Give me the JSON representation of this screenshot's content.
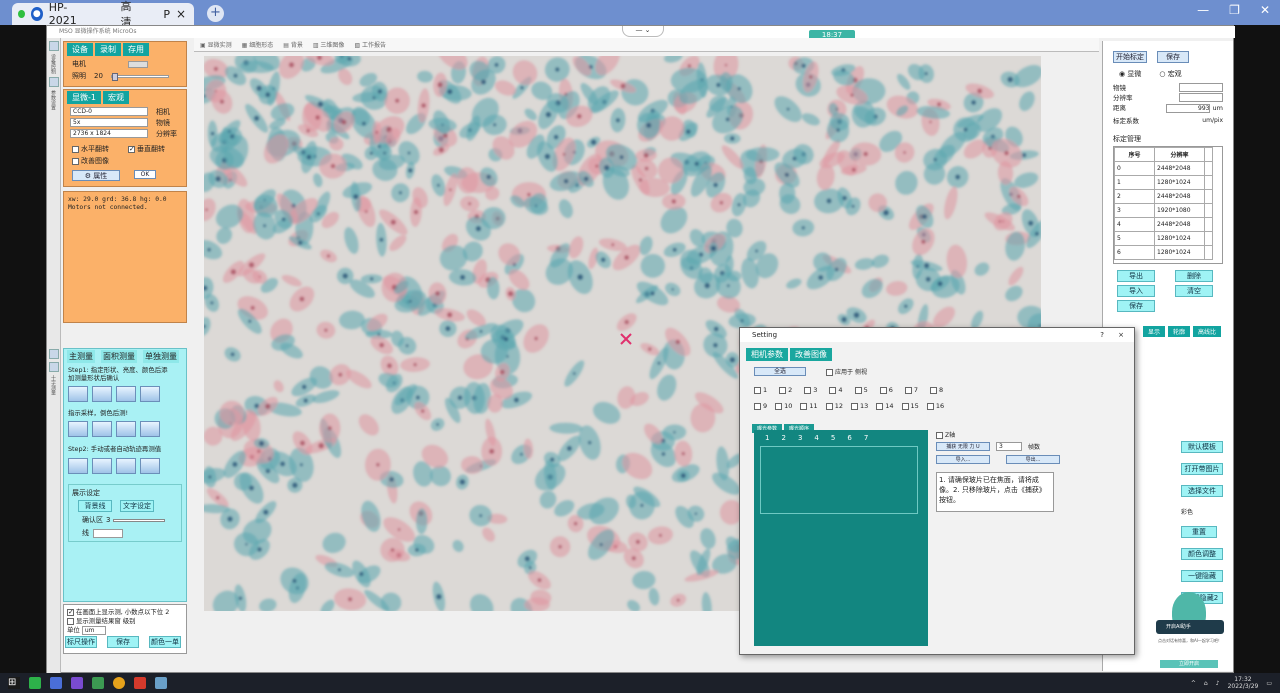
{
  "browser": {
    "tab_title": "HP-2021",
    "tab_quality": "高清",
    "tab_extra": "P",
    "close_glyph": "×",
    "new_tab_glyph": "+"
  },
  "app": {
    "title": "MSO 显微操作系统 MicroOs",
    "time_badge": "18:37",
    "toolbar_items": [
      "显微实测",
      "细胞形态",
      "背景",
      "三维图像",
      "工作报告"
    ]
  },
  "left_rail": {
    "top_label": "设备控制",
    "mid_label": "参数设置",
    "bottom_label": "十字测量"
  },
  "device_panel": {
    "tabs": [
      "设备",
      "录制",
      "存用"
    ],
    "rows": [
      {
        "label": "电机",
        "value": ""
      },
      {
        "label": "照明",
        "value": "20"
      }
    ]
  },
  "camera_panel": {
    "tabs": [
      "显微-1",
      "宏观"
    ],
    "camera": "CCD-0",
    "objective": "5x",
    "resolution": "2736 x 1824",
    "labels": [
      "相机",
      "物镜",
      "分辨率"
    ],
    "checks": [
      {
        "label": "水平翻转",
        "checked": false
      },
      {
        "label": "垂直翻转",
        "checked": true
      },
      {
        "label": "改善图像",
        "checked": false
      }
    ],
    "attr_button": "属性",
    "ok_button": "OK"
  },
  "status_panel": {
    "line1": "xw: 29.0 grd: 36.8 hg: 0.0",
    "line2": "Motors not connected."
  },
  "measure_panel": {
    "tabs": [
      "主测量",
      "面积测量",
      "单独测量"
    ],
    "step1": "Step1: 指定形状、亮度、颜色后添",
    "step1b": "加测量形状后确认",
    "hint": "指示采样，倒色后测!",
    "step2": "Step2: 手动或者自动轨迹再测值",
    "display_title": "展示设定",
    "btn_a": "背景线",
    "btn_b": "文字设定",
    "confirm_label": "确认区",
    "confirm_value": "3",
    "line_label": "线",
    "auto_check": "在画面上显示测, 小数点以下位",
    "auto_check_value": "2",
    "show_result": "显示测量结果窗",
    "level_label": "级别",
    "unit_label": "单位",
    "unit_value": "um",
    "buttons": [
      "标尺操作",
      "保存",
      "颜色一单"
    ]
  },
  "calib_panel": {
    "start_button": "开始标定",
    "save_button": "保存",
    "radio_micro": "显微",
    "radio_macro": "宏观",
    "fields": [
      {
        "label": "物镜",
        "value": ""
      },
      {
        "label": "分辨率",
        "value": ""
      },
      {
        "label": "距离",
        "value": "993",
        "unit": "um"
      }
    ],
    "scale_label": "标定系数",
    "scale_unit": "um/pix",
    "manage_label": "标定管理",
    "table_headers": [
      "序号",
      "分辨率"
    ],
    "table_rows": [
      [
        "0",
        "2448*2048"
      ],
      [
        "1",
        "1280*1024"
      ],
      [
        "2",
        "2448*2048"
      ],
      [
        "3",
        "1920*1080"
      ],
      [
        "4",
        "2448*2048"
      ],
      [
        "5",
        "1280*1024"
      ],
      [
        "6",
        "1280*1024"
      ]
    ],
    "buttons": [
      "导出",
      "删除",
      "导入",
      "清空",
      "保存"
    ],
    "lower_tabs": [
      "显示",
      "轮廓",
      "高线比"
    ],
    "lower_buttons": [
      "默认模板",
      "打开带图片",
      "选择文件",
      "彩色",
      "重置",
      "颜色调整",
      "一键隐藏",
      "一键隐藏2"
    ]
  },
  "dialog": {
    "title": "Setting",
    "help_glyph": "?",
    "close_glyph": "×",
    "tabs": [
      "相机参数",
      "改善图像"
    ],
    "select_button": "全选",
    "apply_label": "应用于",
    "apply_value": "侧视",
    "channels_row1": [
      "1",
      "2",
      "3",
      "4",
      "5",
      "6",
      "7",
      "8"
    ],
    "channels_row2": [
      "9",
      "10",
      "11",
      "12",
      "13",
      "14",
      "15",
      "16"
    ],
    "sub_tabs": [
      "曝光参数",
      "曝光顺序"
    ],
    "slots": [
      "1",
      "2",
      "3",
      "4",
      "5",
      "6",
      "7"
    ],
    "check_label": "Z轴",
    "capture_button": "捕获 无限 力 U",
    "frames_value": "3",
    "frames_label": "帧数",
    "import_button": "导入...",
    "export_button": "导出...",
    "help_text": "1. 请确保玻片已在焦面，请将成像。2. 只移除玻片，点击《捕获》按钮。"
  },
  "assistant": {
    "label": "开启AI助手",
    "sub": "点击对话有惊喜，和AI一起学习吧！",
    "button": "立即开启"
  },
  "taskbar": {
    "time": "17:32",
    "date": "2022/3/29"
  }
}
